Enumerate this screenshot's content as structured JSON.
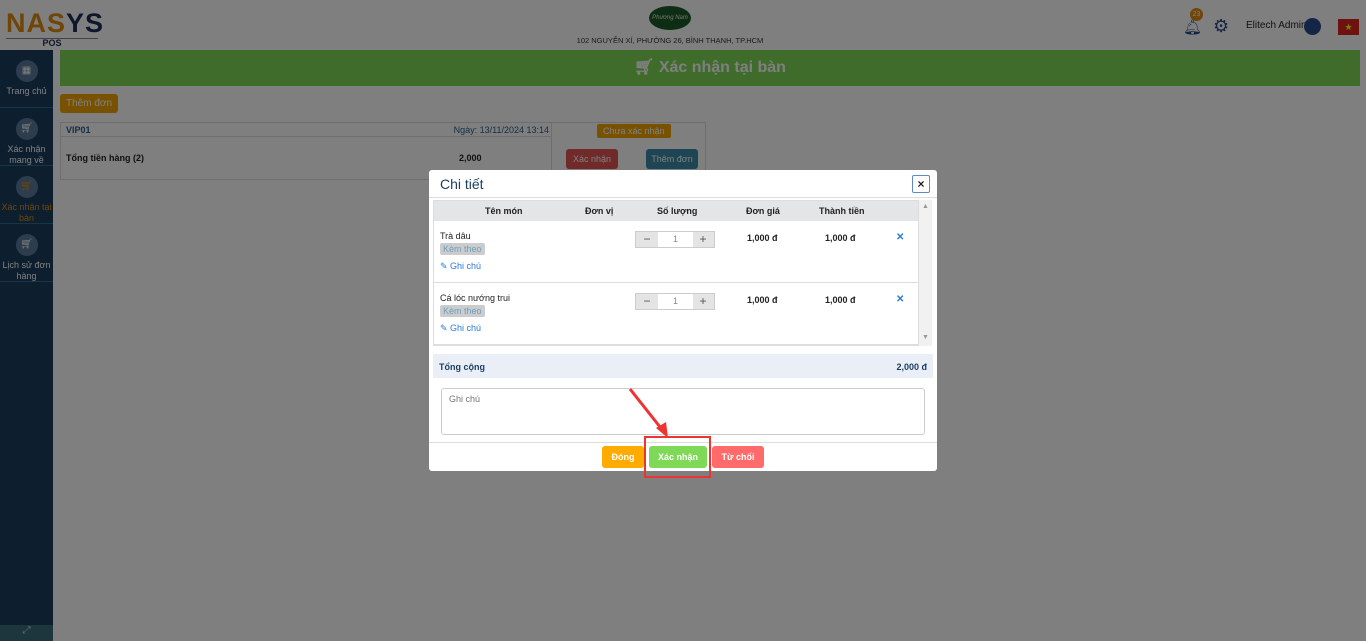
{
  "header": {
    "logo": {
      "part1": "NA",
      "part2": "S",
      "part3": "YS",
      "sub": "POS"
    },
    "store_logo_text": "Phương Nam",
    "address": "102 NGUYỄN XÍ, PHƯỜNG 26, BÌNH THẠNH, TP.HCM",
    "notification_count": "23",
    "user": "Elitech Admin",
    "flag": "★"
  },
  "sidebar": {
    "items": [
      {
        "label": "Trang chủ",
        "icon": "grid-icon"
      },
      {
        "label": "Xác nhận mang về",
        "icon": "cart-icon"
      },
      {
        "label": "Xác nhận tại bàn",
        "icon": "cart-icon",
        "active": true
      },
      {
        "label": "Lịch sử đơn hàng",
        "icon": "cart-icon"
      }
    ]
  },
  "page": {
    "title": "Xác nhận tại bàn",
    "add_order": "Thêm đơn"
  },
  "order": {
    "table": "VIP01",
    "date": "Ngày: 13/11/2024 13:14",
    "total_label": "Tổng tiền hàng (2)",
    "total": "2,000",
    "status": "Chưa xác nhận",
    "confirm": "Xác nhận",
    "add": "Thêm đơn"
  },
  "modal": {
    "title": "Chi tiết",
    "close": "×",
    "columns": [
      "Tên món",
      "Đơn vị",
      "Số lượng",
      "Đơn giá",
      "Thành tiền"
    ],
    "items": [
      {
        "name": "Trà dâu",
        "tag": "Kèm theo",
        "note": "Ghi chú",
        "qty": "1",
        "price": "1,000 đ",
        "amount": "1,000 đ"
      },
      {
        "name": "Cá lóc nướng trui",
        "tag": "Kèm theo",
        "note": "Ghi chú",
        "qty": "1",
        "price": "1,000 đ",
        "amount": "1,000 đ"
      }
    ],
    "total_label": "Tổng cộng",
    "total": "2,000 đ",
    "note_placeholder": "Ghi chú",
    "buttons": {
      "close": "Đóng",
      "confirm": "Xác nhận",
      "reject": "Từ chối"
    }
  },
  "colors": {
    "banner": "#7ed957",
    "sidebar": "#1b3e5f",
    "accent": "#f0a500",
    "danger": "#ff6b6b",
    "highlight": "#ee3333"
  }
}
